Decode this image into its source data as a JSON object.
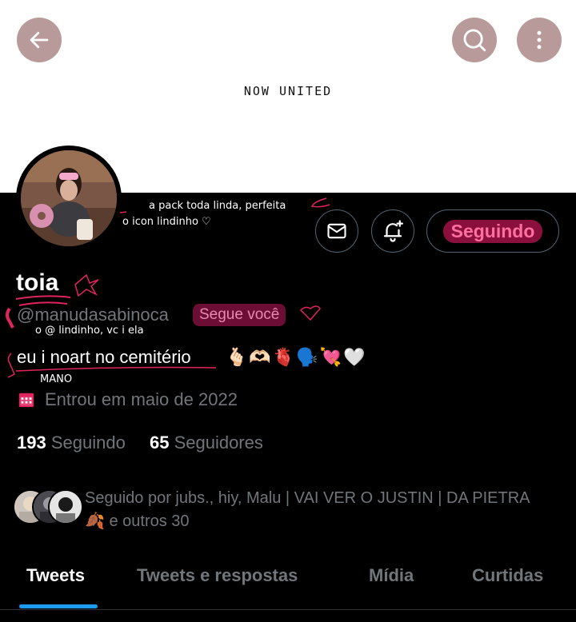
{
  "banner": {
    "title": "NOW UNITED"
  },
  "top_buttons": {
    "back_icon": "arrow-left-icon",
    "search_icon": "search-icon",
    "more_icon": "more-vertical-icon"
  },
  "notes": {
    "pack": "a pack toda linda, perfeita",
    "icon": "o icon lindinho ♡",
    "handle": "o @ lindinho, vc i ela",
    "mano": "MANO"
  },
  "profile": {
    "name": "toia",
    "handle": "@manudasabinoca",
    "follows_you": "Segue você",
    "bio": "eu i noart no cemitério",
    "bio_emojis": "🫰🏻🫶🏻🫀🗣️💘🤍",
    "joined": "Entrou em maio de 2022",
    "following_count": "193",
    "following_label": "Seguindo",
    "followers_count": "65",
    "followers_label": "Seguidores",
    "followed_by": "Seguido por jubs., hiy, Malu | VAI VER O JUSTIN | DA PIETRA🍂 e outros 30"
  },
  "actions": {
    "message_icon": "mail-icon",
    "notify_icon": "bell-plus-icon",
    "follow_label": "Seguindo"
  },
  "tabs": [
    {
      "label": "Tweets",
      "active": true
    },
    {
      "label": "Tweets e respostas"
    },
    {
      "label": "Mídia"
    },
    {
      "label": "Curtidas"
    }
  ],
  "colors": {
    "accent": "#1d9bf0",
    "scribble": "#e0245e",
    "follow_highlight": "#8a0f3c"
  }
}
